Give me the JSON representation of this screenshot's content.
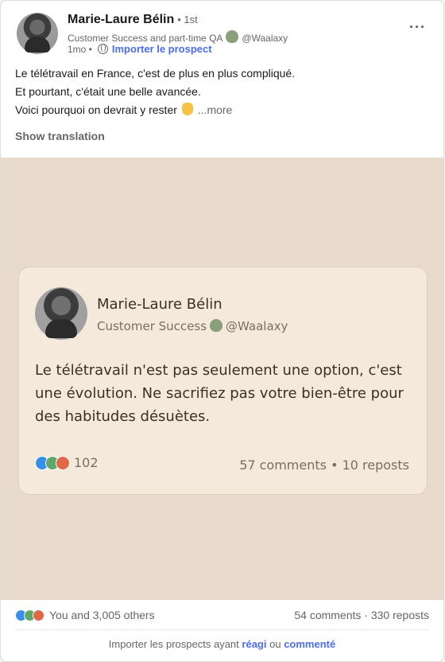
{
  "post": {
    "author_name": "Marie-Laure Bélin",
    "degree": "• 1st",
    "headline": "Customer Success and part-time QA",
    "handle": "@Waalaxy",
    "time": "1mo •",
    "import_label": "Importer le prospect",
    "menu_icon": "more-horizontal-icon",
    "text_lines": [
      "Le télétravail en France, c'est de plus en plus compliqué.",
      "Et pourtant, c'était une belle avancée.",
      "Voici pourquoi on devrait y rester"
    ],
    "more_label": "...more",
    "translation_label": "Show translation"
  },
  "media": {
    "name": "Marie-Laure Bélin",
    "headline": "Customer Success",
    "handle": "@Waalaxy",
    "text": "Le télétravail n'est pas seulement une option, c'est une évolution. Ne sacrifiez pas votre bien-être pour des habitudes désuètes.",
    "reaction_count": "102",
    "stats": "57 comments • 10 reposts",
    "background": "#e8dbcd",
    "card_background": "#f5e9dc"
  },
  "footer": {
    "reactions_text": "You and 3,005 others",
    "stats": "54 comments · 330 reposts",
    "cta_prefix": "Importer les prospects ayant",
    "cta_reacted": "réagi",
    "cta_or": "ou",
    "cta_commented": "commenté"
  },
  "colors": {
    "accent": "#4a6cf7",
    "like": "#378fe9",
    "celebrate": "#5fa86a",
    "love": "#e06847"
  }
}
